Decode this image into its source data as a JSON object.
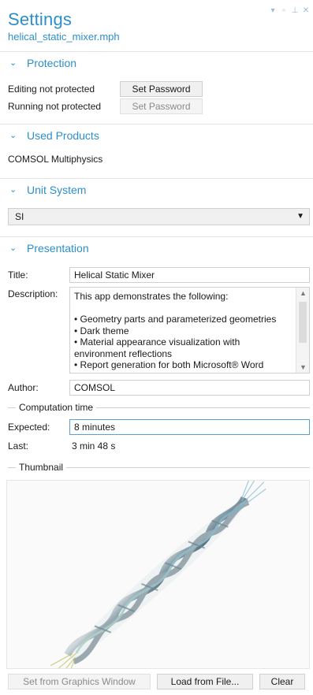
{
  "header": {
    "title": "Settings",
    "subtitle": "helical_static_mixer.mph"
  },
  "colors": {
    "accent": "#2c8fc9"
  },
  "sections": {
    "protection": {
      "label": "Protection",
      "editing_label": "Editing not protected",
      "editing_button": "Set Password",
      "running_label": "Running not protected",
      "running_button": "Set Password"
    },
    "used_products": {
      "label": "Used Products",
      "product": "COMSOL Multiphysics"
    },
    "unit_system": {
      "label": "Unit System",
      "selected": "SI"
    },
    "presentation": {
      "label": "Presentation",
      "title_label": "Title:",
      "title_value": "Helical Static Mixer",
      "description_label": "Description:",
      "description_value": "This app demonstrates the following:\n\n• Geometry parts and parameterized geometries\n• Dark theme\n• Material appearance visualization with environment reflections\n• Report generation for both Microsoft® Word",
      "author_label": "Author:",
      "author_value": "COMSOL",
      "computation_time_label": "Computation time",
      "expected_label": "Expected:",
      "expected_value": "8 minutes",
      "last_label": "Last:",
      "last_value": "3 min 48 s",
      "thumbnail_label": "Thumbnail"
    }
  },
  "buttons": {
    "set_from_graphics": "Set from Graphics Window",
    "load_from_file": "Load from File...",
    "clear": "Clear"
  }
}
